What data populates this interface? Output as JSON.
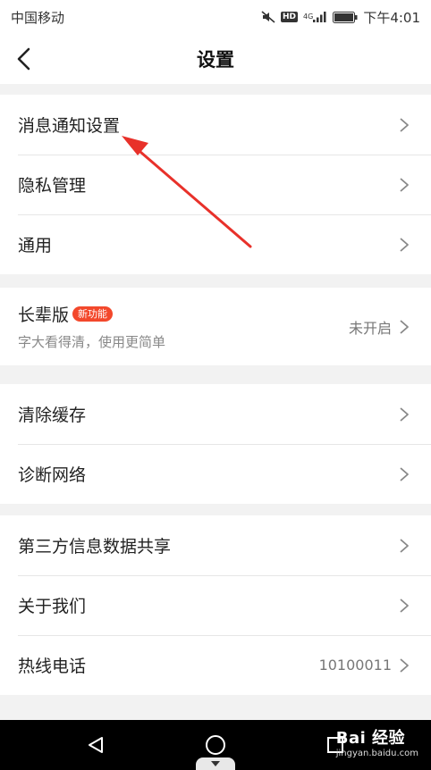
{
  "status_bar": {
    "carrier": "中国移动",
    "hd": "HD",
    "network": "4G",
    "time": "下午4:01"
  },
  "header": {
    "title": "设置"
  },
  "groups": [
    {
      "items": [
        {
          "label": "消息通知设置"
        },
        {
          "label": "隐私管理"
        },
        {
          "label": "通用"
        }
      ]
    },
    {
      "items": [
        {
          "label": "长辈版",
          "badge": "新功能",
          "sub": "字大看得清，使用更简单",
          "value": "未开启"
        }
      ]
    },
    {
      "items": [
        {
          "label": "清除缓存"
        },
        {
          "label": "诊断网络"
        }
      ]
    },
    {
      "items": [
        {
          "label": "第三方信息数据共享"
        },
        {
          "label": "关于我们"
        },
        {
          "label": "热线电话",
          "value": "10100011"
        }
      ]
    }
  ],
  "watermark": {
    "main": "Bai 经验",
    "sub": "jingyan.baidu.com"
  },
  "colors": {
    "accent": "#f3482b",
    "annotation": "#e8312a",
    "background": "#f2f2f2"
  },
  "icons": [
    "back-arrow-icon",
    "chevron-right-icon",
    "mute-icon",
    "signal-icon",
    "battery-icon",
    "nav-back-icon",
    "nav-home-icon",
    "nav-recents-icon"
  ]
}
